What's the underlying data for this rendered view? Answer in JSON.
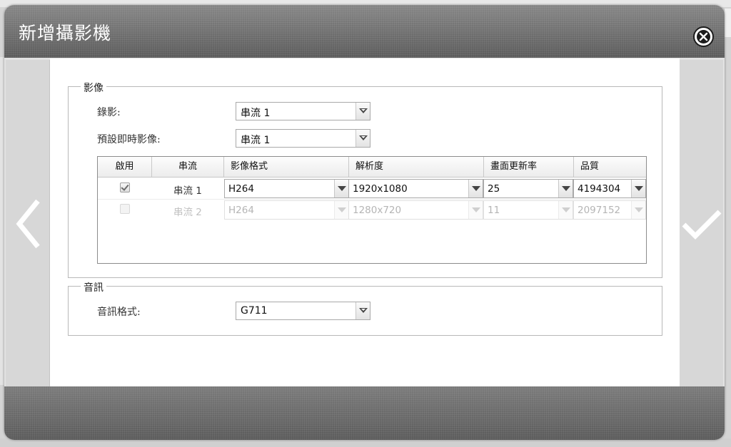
{
  "dialog": {
    "title": "新增攝影機"
  },
  "video": {
    "legend": "影像",
    "recording_label": "錄影:",
    "recording_value": "串流 1",
    "live_label": "預設即時影像:",
    "live_value": "串流 1",
    "table": {
      "headers": [
        "啟用",
        "串流",
        "影像格式",
        "解析度",
        "畫面更新率",
        "品質"
      ],
      "rows": [
        {
          "enabled": true,
          "stream": "串流 1",
          "format": "H264",
          "resolution": "1920x1080",
          "fps": "25",
          "quality": "4194304",
          "disabled": false
        },
        {
          "enabled": false,
          "stream": "串流 2",
          "format": "H264",
          "resolution": "1280x720",
          "fps": "11",
          "quality": "2097152",
          "disabled": true
        }
      ]
    }
  },
  "audio": {
    "legend": "音訊",
    "format_label": "音訊格式:",
    "format_value": "G711"
  },
  "icons": {
    "close": "close-circle-icon",
    "prev": "chevron-left-icon",
    "confirm": "checkmark-icon"
  }
}
